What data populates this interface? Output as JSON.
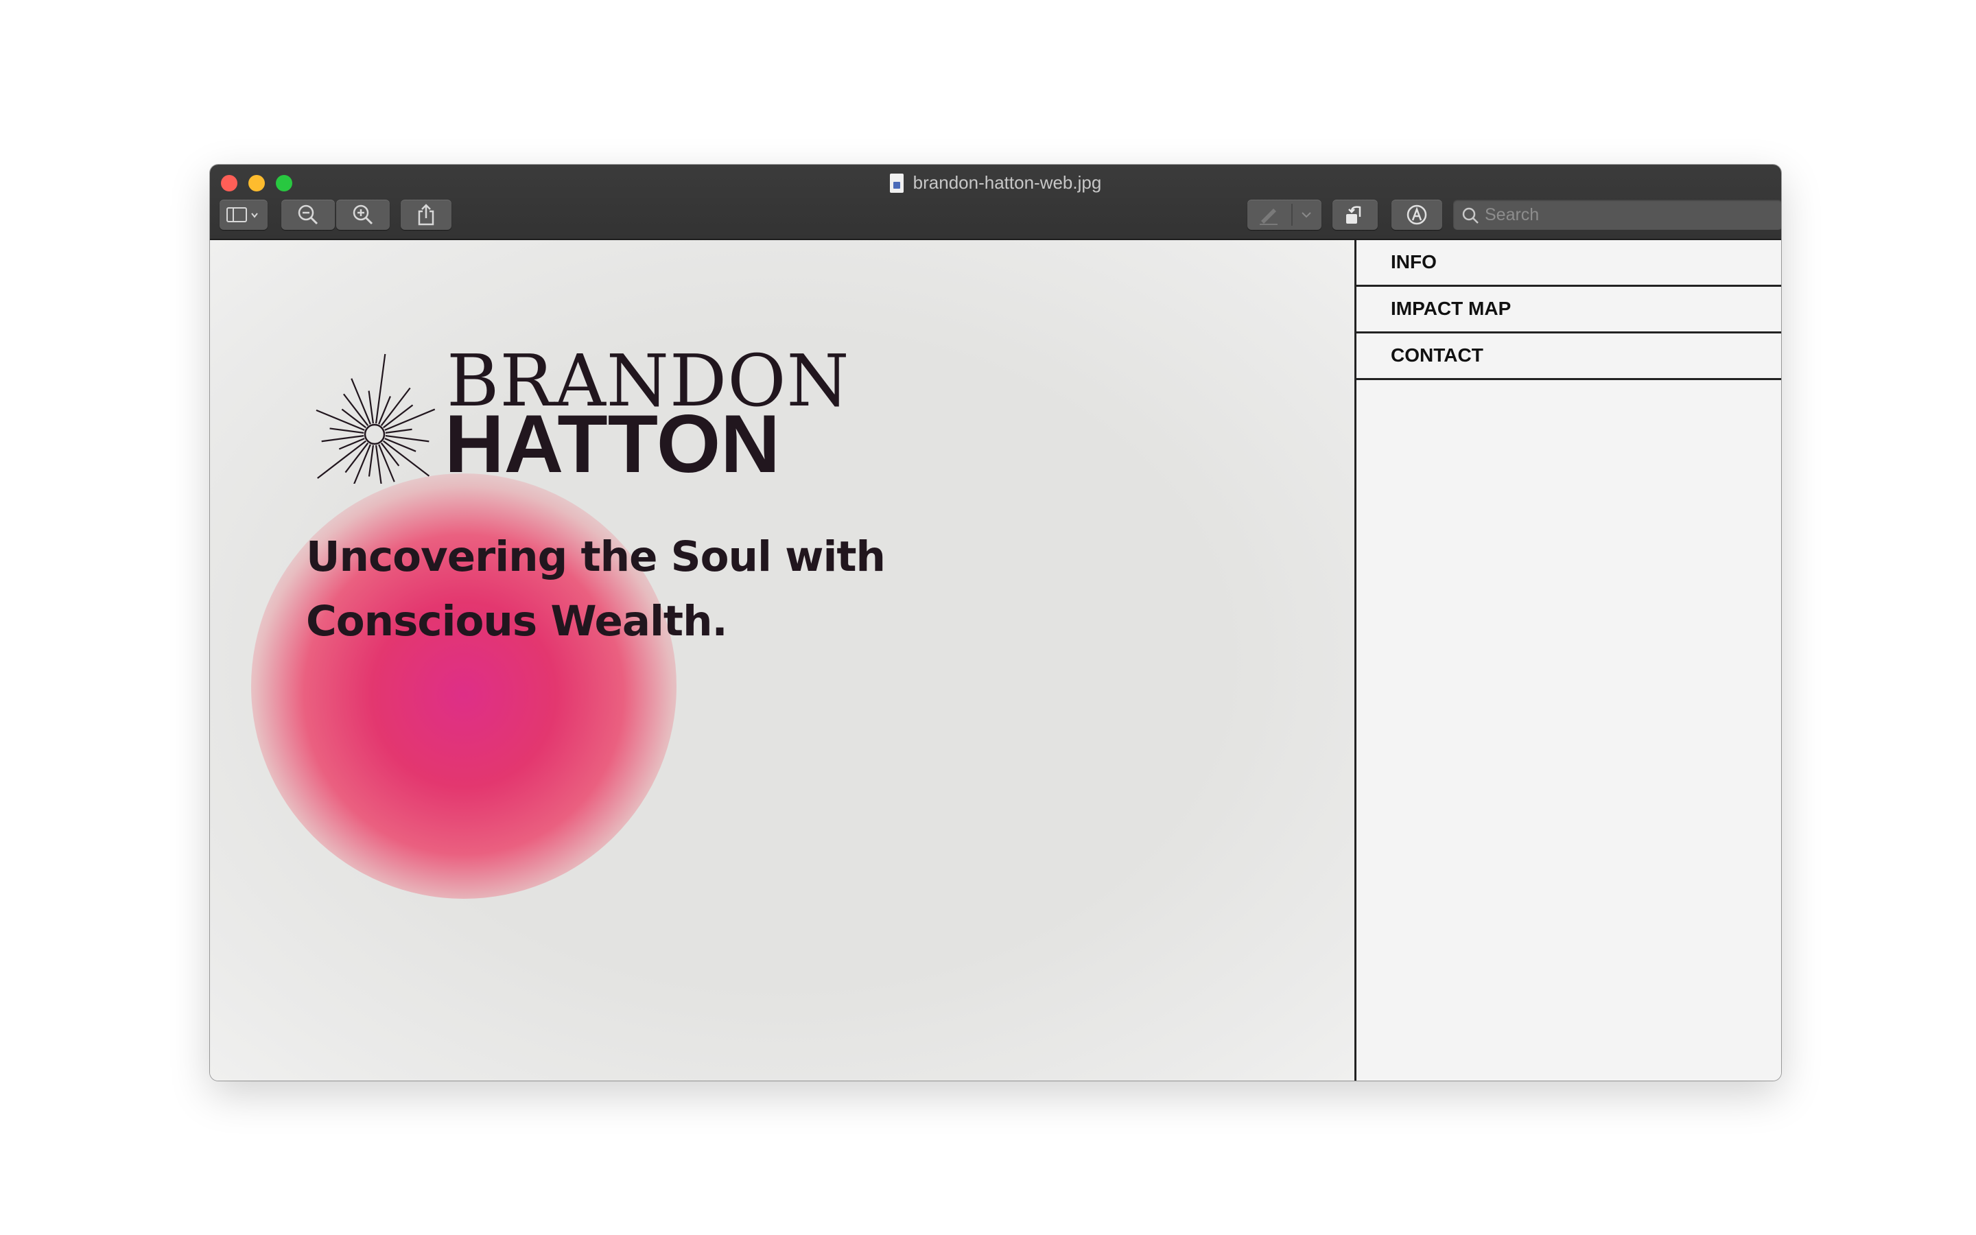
{
  "window": {
    "title": "brandon-hatton-web.jpg"
  },
  "toolbar": {
    "search_placeholder": "Search",
    "buttons": [
      {
        "name": "sidebar-toggle",
        "icon": "sidebar-icon"
      },
      {
        "name": "zoom-out",
        "icon": "zoom-out-icon"
      },
      {
        "name": "zoom-in",
        "icon": "zoom-in-icon"
      },
      {
        "name": "share",
        "icon": "share-icon"
      },
      {
        "name": "markup-pen",
        "icon": "pen-icon"
      },
      {
        "name": "rotate",
        "icon": "rotate-icon"
      },
      {
        "name": "markup-toolbar",
        "icon": "markup-icon"
      }
    ]
  },
  "site": {
    "logo_top": "BRANDON",
    "logo_bottom": "HATTON",
    "tagline_line1": "Uncovering the Soul with",
    "tagline_line2": "Conscious Wealth.",
    "accent_color": "#e0357a"
  },
  "nav": {
    "items": [
      {
        "label": "INFO"
      },
      {
        "label": "IMPACT MAP"
      },
      {
        "label": "CONTACT"
      }
    ]
  }
}
